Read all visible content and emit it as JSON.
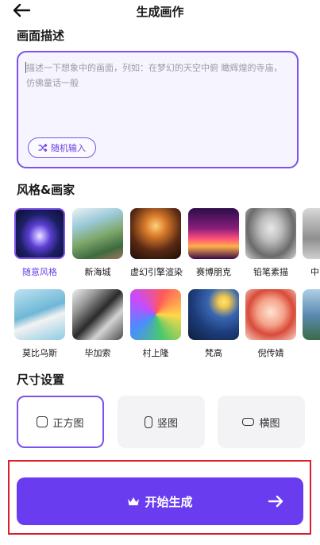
{
  "header": {
    "title": "生成画作"
  },
  "description": {
    "heading": "画面描述",
    "placeholder": "描述一下想象中的画面，列如：在梦幻的天空中俯 瞰辉煌的寺庙，仿佛童话一般",
    "random_button": "随机输入"
  },
  "styles": {
    "heading": "风格&画家",
    "items": [
      {
        "label": "随意风格",
        "selected": true
      },
      {
        "label": "新海城"
      },
      {
        "label": "虚幻引擎渲染"
      },
      {
        "label": "赛博朋克"
      },
      {
        "label": "铅笔素描"
      },
      {
        "label": "中"
      },
      {
        "label": "莫比乌斯"
      },
      {
        "label": "毕加索"
      },
      {
        "label": "村上隆"
      },
      {
        "label": "梵高"
      },
      {
        "label": "倪传婧"
      },
      {
        "label": ""
      }
    ]
  },
  "size": {
    "heading": "尺寸设置",
    "options": [
      {
        "label": "正方图",
        "selected": true
      },
      {
        "label": "竖图"
      },
      {
        "label": "横图"
      }
    ]
  },
  "cta": {
    "label": "开始生成"
  },
  "colors": {
    "accent": "#7b52ea",
    "cta": "#6a3cf0",
    "highlight": "#d9202a"
  }
}
